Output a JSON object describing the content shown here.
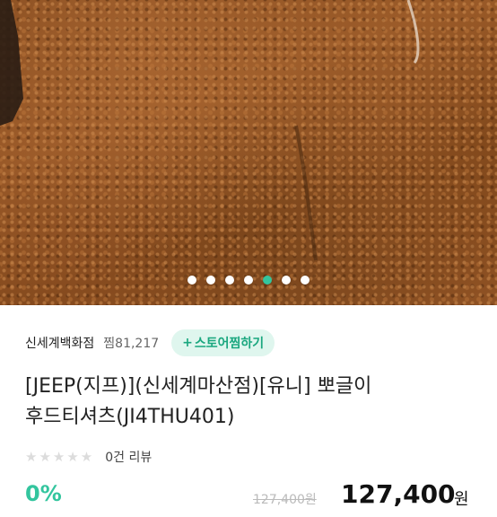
{
  "carousel": {
    "count": 7,
    "active_index": 4
  },
  "store": {
    "name": "신세계백화점",
    "likes": "찜81,217",
    "follow_label": "스토어찜하기",
    "follow_icon": "plus-icon"
  },
  "product": {
    "title_line1": "[JEEP(지프)](신세계마산점)[유니] 뽀글이",
    "title_line2": "후드티셔츠(JI4THU401)",
    "rating_stars": 0,
    "review_count": "0건 리뷰",
    "discount": "0%",
    "original_price": "127,400원",
    "sale_price": "127,400",
    "currency": "원"
  },
  "colors": {
    "accent": "#33c59e",
    "follow_bg": "#dff6ee",
    "star_empty": "#dcdcdc",
    "image_tone": "#8a4f22"
  }
}
